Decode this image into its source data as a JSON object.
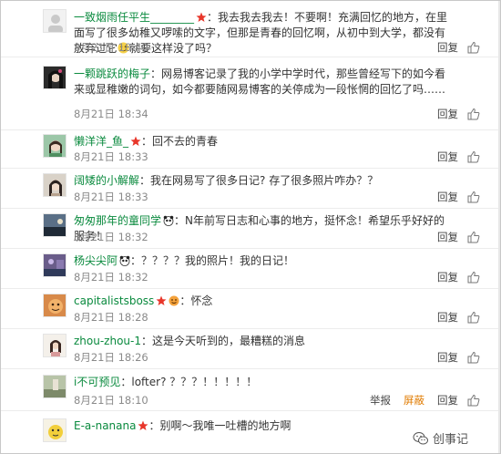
{
  "comments": [
    {
      "author": "一致烟雨任平生________",
      "text": "我去我去我去！不要啊！充满回忆的地方，在里面写了很多幼稚又啰嗦的文字，但那是青春的回忆啊，从初中到大学，都没有放弃过它",
      "text_after_emoji": "就要这样没了吗？",
      "time": "8月21日 18:40",
      "actions": [
        "回复"
      ]
    },
    {
      "author": "一颗跳跃的梅子",
      "text": "网易博客记录了我的小学中学时代，那些曾经写下的如今看来或显稚嫩的词句，如今都要随网易博客的关停成为一段怅惘的回忆了吗……",
      "time": "8月21日 18:34",
      "actions": [
        "回复"
      ]
    },
    {
      "author": "懒洋洋_鱼_",
      "text": "回不去的青春",
      "time": "8月21日 18:33",
      "actions": [
        "回复"
      ]
    },
    {
      "author": "阔矮的小解解",
      "text": "我在网易写了很多日记? 存了很多照片咋办？？",
      "time": "8月21日 18:33",
      "actions": [
        "回复"
      ]
    },
    {
      "author": "匆匆那年的童同学",
      "text": "N年前写日志和心事的地方，挺怀念！希望乐乎好好的服务！",
      "time": "8月21日 18:32",
      "actions": [
        "回复"
      ]
    },
    {
      "author": "杨尖尖阿",
      "text": "？？？？我的照片！我的日记！",
      "time": "8月21日 18:32",
      "actions": [
        "回复"
      ]
    },
    {
      "author": "capitalistsboss",
      "text": "怀念",
      "time": "8月21日 18:28",
      "actions": [
        "回复"
      ]
    },
    {
      "author": "zhou-zhou-1",
      "text": "这是今天听到的，最糟糕的消息",
      "time": "8月21日 18:26",
      "actions": [
        "回复"
      ]
    },
    {
      "author": "i不可预见",
      "text": "lofter? ？？？！！！！！",
      "time": "8月21日 18:10",
      "actions": [
        "举报",
        "屏蔽",
        "回复"
      ]
    },
    {
      "author": "E-a-nanana",
      "text": "别啊～我唯一吐槽的地方啊",
      "time": "",
      "actions": []
    }
  ],
  "colors": {
    "author": "#0a8a3e",
    "time": "#8a8a8a",
    "badge_red": "#e8362a",
    "block_orange": "#e07b00"
  },
  "watermark": {
    "text": "创事记",
    "icon": "wechat-icon"
  }
}
